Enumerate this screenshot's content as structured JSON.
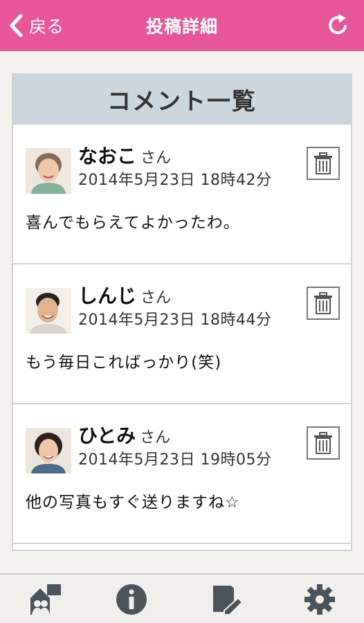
{
  "header": {
    "back_label": "戻る",
    "title": "投稿詳細",
    "color": "#e8579a"
  },
  "card": {
    "title": "コメント一覧"
  },
  "comments": [
    {
      "name": "なおこ",
      "honorific": "さん",
      "date": "2014年5月23日 18時42分",
      "text": "喜んでもらえてよかったわ。"
    },
    {
      "name": "しんじ",
      "honorific": "さん",
      "date": "2014年5月23日 18時44分",
      "text": "もう毎日こればっかり(笑)"
    },
    {
      "name": "ひとみ",
      "honorific": "さん",
      "date": "2014年5月23日 19時05分",
      "text": "他の写真もすぐ送りますね☆"
    }
  ],
  "tabbar": {
    "icons": [
      "family-album-icon",
      "info-icon",
      "edit-post-icon",
      "settings-gear-icon"
    ]
  }
}
